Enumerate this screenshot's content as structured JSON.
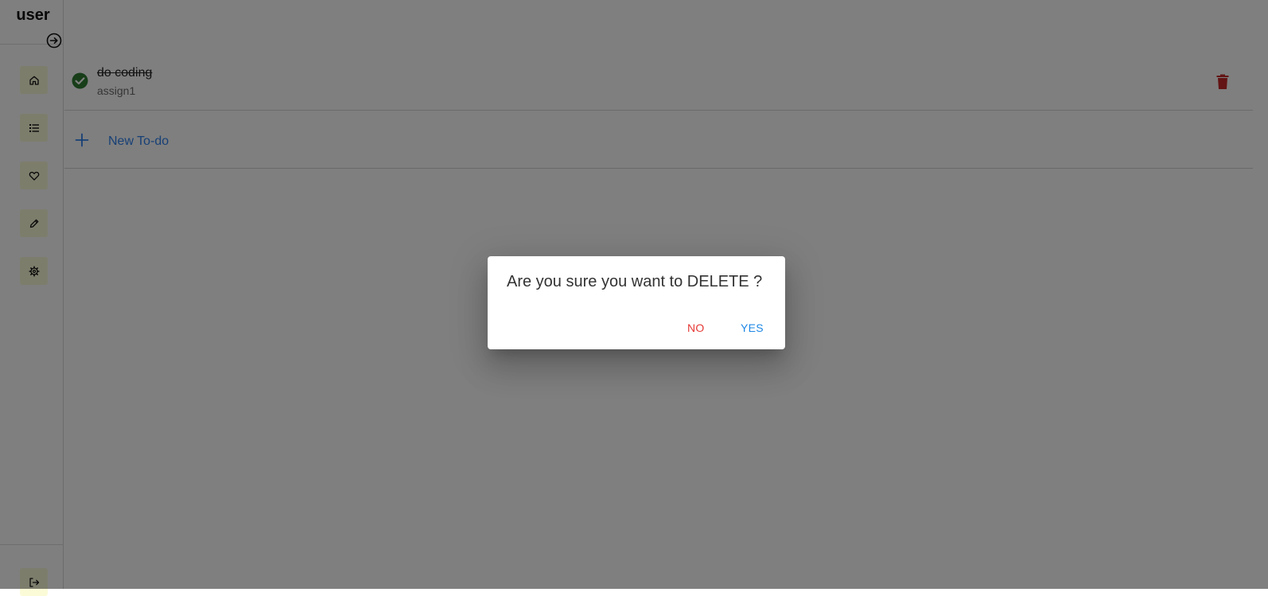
{
  "sidebar": {
    "user_name": "user",
    "nav_items": [
      {
        "icon": "home-icon"
      },
      {
        "icon": "list-icon"
      },
      {
        "icon": "heart-icon"
      },
      {
        "icon": "pencil-icon"
      },
      {
        "icon": "gear-icon"
      }
    ],
    "logout_icon": "logout-icon"
  },
  "todos": [
    {
      "title": "do coding",
      "subtitle": "assign1",
      "completed": true
    }
  ],
  "new_todo": {
    "label": "New To-do"
  },
  "dialog": {
    "message": "Are you sure you want to DELETE ?",
    "no_label": "NO",
    "yes_label": "YES"
  },
  "colors": {
    "nav_button_bg": "#fbfbd8",
    "check_green": "#2e7d32",
    "trash_red": "#c62828",
    "accent_blue": "#2f80ed",
    "no_red": "#e53935",
    "yes_blue": "#1e88e5"
  }
}
